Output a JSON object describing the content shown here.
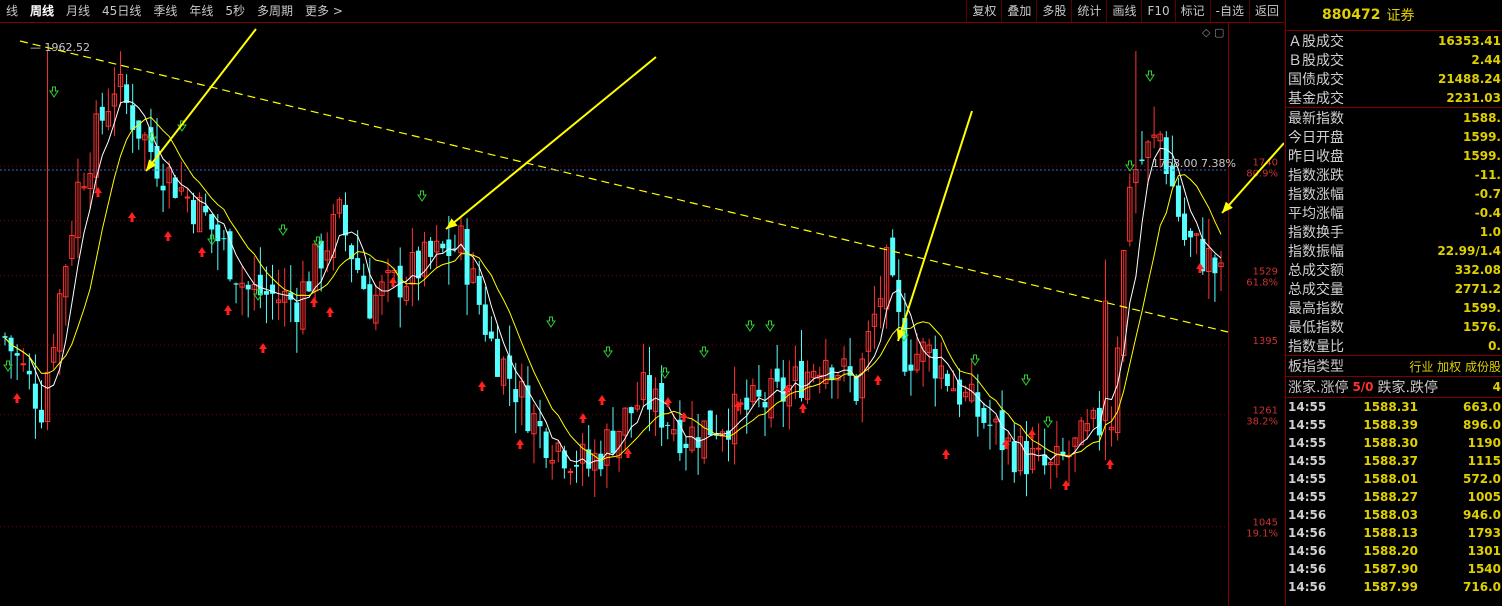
{
  "toolbar": {
    "tabs": [
      "线",
      "周线",
      "月线",
      "45日线",
      "季线",
      "年线",
      "5秒",
      "多周期",
      "更多 >"
    ],
    "active_tab": "周线",
    "tools": [
      "复权",
      "叠加",
      "多股",
      "统计",
      "画线",
      "F10",
      "标记",
      "-自选",
      "返回"
    ]
  },
  "chart": {
    "top_label": "— 1962.52",
    "trend_label": "1768.00 7.38%",
    "right_axis": [
      {
        "value": "1740",
        "pct": "80.9%"
      },
      {
        "value": "1529",
        "pct": "61.8%"
      },
      {
        "value": "1395",
        "pct": ""
      },
      {
        "value": "1261",
        "pct": "38.2%"
      },
      {
        "value": "1045",
        "pct": "19.1%"
      }
    ],
    "colors": {
      "up": "#ff3232",
      "down": "#54ffff",
      "ma_white": "#ffffff",
      "ma_yellow": "#ffff00",
      "trendline": "#ffff00",
      "grid": "#800000",
      "arrow_buy": "#ff2020",
      "arrow_sell": "#30d030"
    }
  },
  "chart_data": {
    "type": "candlestick",
    "title": "",
    "ylim": [
      1000,
      1970
    ],
    "marked_high": 1962.52
  },
  "sidebar": {
    "code": "880472",
    "name": "证券",
    "stats": [
      {
        "k": "Ａ股成交",
        "v": "16353.41"
      },
      {
        "k": "Ｂ股成交",
        "v": "2.44"
      },
      {
        "k": "国债成交",
        "v": "21488.24"
      },
      {
        "k": "基金成交",
        "v": "2231.03"
      }
    ],
    "index": [
      {
        "k": "最新指数",
        "v": "1588."
      },
      {
        "k": "今日开盘",
        "v": "1599."
      },
      {
        "k": "昨日收盘",
        "v": "1599."
      },
      {
        "k": "指数涨跌",
        "v": "-11."
      },
      {
        "k": "指数涨幅",
        "v": "-0.7"
      },
      {
        "k": "平均涨幅",
        "v": "-0.4"
      },
      {
        "k": "指数换手",
        "v": "1.0"
      },
      {
        "k": "指数振幅",
        "v": "22.99/1.4"
      },
      {
        "k": "总成交额",
        "v": "332.08"
      },
      {
        "k": "总成交量",
        "v": "2771.2"
      },
      {
        "k": "最高指数",
        "v": "1599."
      },
      {
        "k": "最低指数",
        "v": "1576."
      },
      {
        "k": "指数量比",
        "v": "0."
      }
    ],
    "type_label": "板指类型",
    "type_value": "行业 加权 成份股",
    "updown": {
      "up_label": "涨家.涨停",
      "up_value": "5/0",
      "down_label": "跌家.跌停",
      "down_value": "4"
    },
    "ticks": [
      {
        "t": "14:55",
        "p": "1588.31",
        "v": "663.0"
      },
      {
        "t": "14:55",
        "p": "1588.39",
        "v": "896.0"
      },
      {
        "t": "14:55",
        "p": "1588.30",
        "v": "1190"
      },
      {
        "t": "14:55",
        "p": "1588.37",
        "v": "1115"
      },
      {
        "t": "14:55",
        "p": "1588.01",
        "v": "572.0"
      },
      {
        "t": "14:55",
        "p": "1588.27",
        "v": "1005"
      },
      {
        "t": "14:56",
        "p": "1588.03",
        "v": "946.0"
      },
      {
        "t": "14:56",
        "p": "1588.13",
        "v": "1793"
      },
      {
        "t": "14:56",
        "p": "1588.20",
        "v": "1301"
      },
      {
        "t": "14:56",
        "p": "1587.90",
        "v": "1540"
      },
      {
        "t": "14:56",
        "p": "1587.99",
        "v": "716.0"
      }
    ]
  }
}
